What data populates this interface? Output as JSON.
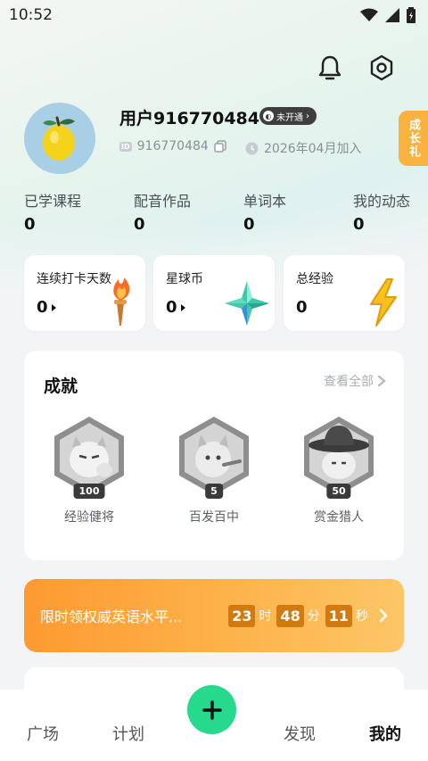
{
  "status_bar": {
    "time": "10:52"
  },
  "profile": {
    "username": "用户916770484",
    "vip_badge": "未开通",
    "id_tag": "ID",
    "id": "916770484",
    "joined": "2026年04月加入",
    "growth_tab": "成长礼"
  },
  "stats": [
    {
      "label": "已学课程",
      "value": "0"
    },
    {
      "label": "配音作品",
      "value": "0"
    },
    {
      "label": "单词本",
      "value": "0"
    },
    {
      "label": "我的动态",
      "value": "0"
    }
  ],
  "cards": [
    {
      "title": "连续打卡天数",
      "value": "0",
      "icon": "torch-icon"
    },
    {
      "title": "星球币",
      "value": "0",
      "icon": "crystal-star-icon"
    },
    {
      "title": "总经验",
      "value": "0",
      "icon": "lightning-icon"
    }
  ],
  "achievements": {
    "title": "成就",
    "view_all": "查看全部",
    "badges": [
      {
        "label": "经验健将",
        "level": "100",
        "icon": "muscle-cat-badge-icon"
      },
      {
        "label": "百发百中",
        "level": "5",
        "icon": "archer-cat-badge-icon"
      },
      {
        "label": "赏金猎人",
        "level": "50",
        "icon": "cowboy-cat-badge-icon"
      }
    ]
  },
  "promo": {
    "text": "限时领权威英语水平...",
    "hours": "23",
    "hours_unit": "时",
    "minutes": "48",
    "minutes_unit": "分",
    "seconds": "11",
    "seconds_unit": "秒"
  },
  "tabbar": {
    "tabs": [
      "广场",
      "计划",
      "发现",
      "我的"
    ],
    "active": "我的",
    "fab_icon": "plus-icon"
  },
  "colors": {
    "accent_green": "#27d98d",
    "promo_orange": "#fd9a31",
    "growth_tab": "#f9b23d"
  }
}
